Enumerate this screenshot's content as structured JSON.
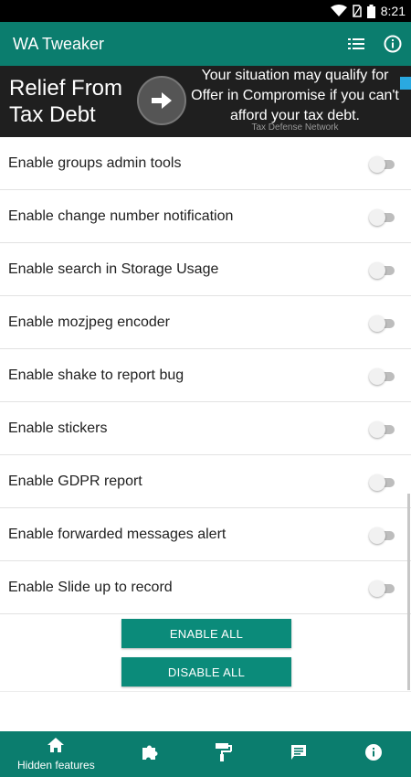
{
  "status_bar": {
    "time": "8:21"
  },
  "app_bar": {
    "title": "WA Tweaker",
    "icons": [
      "list-icon",
      "info-icon"
    ]
  },
  "ad": {
    "headline": "Relief From Tax Debt",
    "body": "Your situation may qualify for Offer in Compromise if you can't afford your tax debt.",
    "source": "Tax Defense Network"
  },
  "settings": {
    "items": [
      {
        "label": "Enable groups admin tools",
        "enabled": false
      },
      {
        "label": "Enable change number notification",
        "enabled": false
      },
      {
        "label": "Enable search in Storage Usage",
        "enabled": false
      },
      {
        "label": "Enable mozjpeg encoder",
        "enabled": false
      },
      {
        "label": "Enable shake to report bug",
        "enabled": false
      },
      {
        "label": "Enable stickers",
        "enabled": false
      },
      {
        "label": "Enable GDPR report",
        "enabled": false
      },
      {
        "label": "Enable forwarded messages alert",
        "enabled": false
      },
      {
        "label": "Enable Slide up to record",
        "enabled": false
      }
    ]
  },
  "buttons": {
    "enable_all": "ENABLE ALL",
    "disable_all": "DISABLE ALL"
  },
  "bottom_nav": {
    "items": [
      {
        "icon": "home-icon",
        "label": "Hidden features",
        "active": true
      },
      {
        "icon": "puzzle-icon",
        "label": ""
      },
      {
        "icon": "paint-roller-icon",
        "label": ""
      },
      {
        "icon": "message-icon",
        "label": ""
      },
      {
        "icon": "info-icon",
        "label": ""
      }
    ]
  },
  "colors": {
    "primary": "#0b7d6e",
    "button": "#0b8b7a",
    "ad_background": "#1f1f1f"
  }
}
